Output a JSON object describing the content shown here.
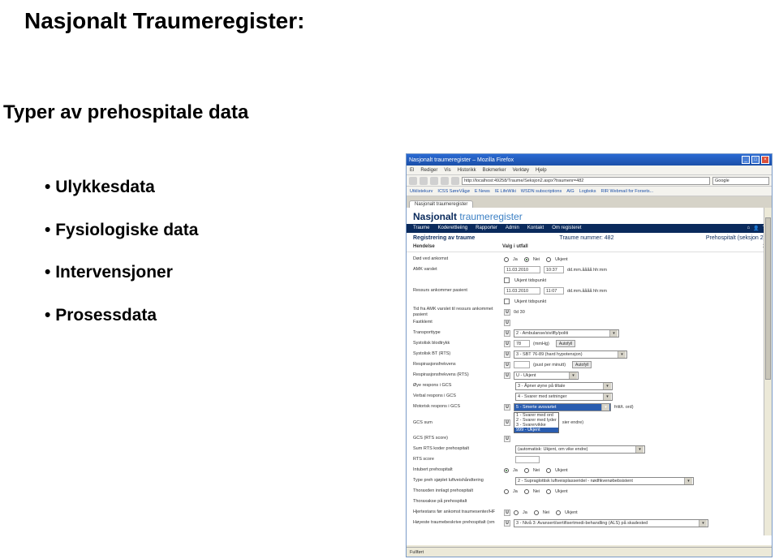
{
  "page": {
    "title": "Nasjonalt Traumeregister:",
    "subtitle": "Typer av prehospitale data",
    "bullets": [
      "Ulykkesdata",
      "Fysiologiske data",
      "Intervensjoner",
      "Prosessdata"
    ]
  },
  "browser": {
    "window_title": "Nasjonalt traumeregister – Mozilla Firefox",
    "menu": [
      "El",
      "Rediger",
      "Vis",
      "Historikk",
      "Bokmerker",
      "Verktøy",
      "Hjelp"
    ],
    "url": "http://localhost:49258/Traume/Seksjon2.aspx?traumenr=482",
    "search_engine": "Google",
    "bookmarks": [
      "Utklistekurv",
      "ICSS SøreVågø",
      "E News",
      "IE LifeWiki",
      "WSDN subscriptions",
      "AIG",
      "Logboks",
      "RIR Webmail for Forsets..."
    ],
    "tab": "Nasjonalt traumeregister",
    "status": "Fullført"
  },
  "app": {
    "title_bold": "Nasjonalt",
    "title_light": "traumeregister",
    "nav": [
      "Traume",
      "Koderettleiing",
      "Rapporter",
      "Admin",
      "Kontakt",
      "Om registeret"
    ],
    "reg": {
      "h1": "Registrering av traume",
      "h2": "Traume nummer: 482",
      "h3": "Prehospitalt (seksjon 2)",
      "hendelse": "Hendelse",
      "valg": "Valg i utfall",
      "one": "1"
    },
    "rows": {
      "dod_ankomst": "Død ved ankomst",
      "amk_varslet": "AMK varslet",
      "amk_date": "11.03.2010",
      "amk_time": "10:37",
      "amk_fmt": "dd.mm.åååå hh:mm",
      "ukjent_tid": "Ukjent tidspunkt",
      "ressurs": "Ressurs ankommer pasient",
      "ressurs_date": "11.03.2010",
      "ressurs_time": "11:07",
      "ressurs_fmt": "dd.mm.åååå hh:mm",
      "tid_amk": "Tid fra AMK varslet til ressurs ankommet pasient",
      "tid_amk_val": "0d 30",
      "fastklemt": "Fastklemt",
      "transport": "Transporttype",
      "transport_val": "2 - Ambulanse/sivilfly/politi",
      "systolisk": "Systolisk blodtrykk",
      "systolisk_val": "78",
      "systolisk_unit": "(mmHg)",
      "autofyll": "Autofyll",
      "sbt": "Systolisk BT (RTS)",
      "sbt_val": "3 - SBT 76-89 (hard hypotensjon)",
      "resp": "Respirasjonsfrekvens",
      "resp_unit": "(pust per minutt)",
      "respk": "Respirasjonsfrekvens (RTS)",
      "respk_val": "U - Ukjent",
      "oye": "Øye respons i GCS",
      "oye_val": "3 - Åpner øyne på tiltale",
      "verbal": "Verbal respons i GCS",
      "verbal_val": "4 - Svarer med setninger",
      "motorisk": "Motorisk respons i GCS",
      "motorisk_val": "5 - Smerte avsvartet",
      "fritt_ord": "fritt/t. ord)",
      "gcs": "GCS sum",
      "gcs_rts": "GCS (RTS score)",
      "sum_rts": "Sum RTS koder prehospitalt",
      "sum_rts_val": "(automatisk: Ukjent, om vike endre)",
      "rts_score": "RTS score",
      "intubert": "Intubert prehospitalt",
      "type_luft": "Type preh sjøplet luftveishåndtering",
      "type_luft_val": "2 - Supraglottisk luftveisplasseridel - nødfikvenøbebsistent",
      "thorax": "Thoraxden innlagt prehospitalt",
      "thorax2": "Thoraxakse på prehospitalt",
      "hjertestans": "Hjertestans før ankomst traumesenter/HF",
      "hoyeste": "Høyeste traumebeskrive prehospitalt (om",
      "hoyeste_val": "3 - Nivå 3: Avansert/sertifisertmedi-behandling (ALS) på skadested",
      "ja": "Ja",
      "nei": "Nei",
      "ukjent": "Ukjent",
      "dd_items": [
        "1 - Svarer med ord",
        "2 - Svarer med lyder",
        "3 - Svarervikke",
        "999 - Ukjent"
      ],
      "dd_more": "sier endre)"
    }
  }
}
